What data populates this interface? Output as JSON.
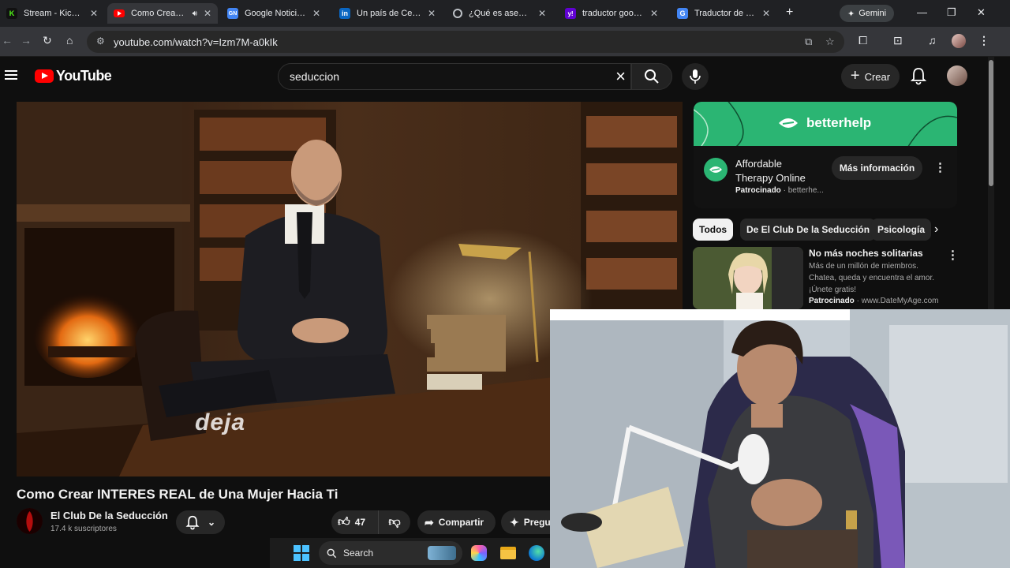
{
  "browser": {
    "tabs": [
      {
        "title": "Stream - Kick Dash",
        "favicon_text": "K",
        "favicon_color": "#53fc18",
        "active": false
      },
      {
        "title": "Como Crear INT",
        "favicon_text": "",
        "favicon_color": "#ff0000",
        "active": true
      },
      {
        "title": "Google Noticias - I",
        "favicon_text": "GN",
        "favicon_color": "#4285f4",
        "active": false
      },
      {
        "title": "Un país de Centro",
        "favicon_text": "in",
        "favicon_color": "#0a66c2",
        "active": false
      },
      {
        "title": "¿Qué es asequibili",
        "favicon_text": "",
        "favicon_color": "#9aa0a6",
        "active": false
      },
      {
        "title": "traductor google -",
        "favicon_text": "y!",
        "favicon_color": "#6001d2",
        "active": false
      },
      {
        "title": "Traductor de Goog",
        "favicon_text": "G",
        "favicon_color": "#4285f4",
        "active": false
      }
    ],
    "gemini_label": "Gemini",
    "url": "youtube.com/watch?v=Izm7M-a0kIk"
  },
  "youtube": {
    "logo_text": "YouTube",
    "search_query": "seduccion",
    "create_label": "Crear",
    "video": {
      "caption": "deja",
      "title": "Como Crear INTERES REAL de Una Mujer Hacia Ti",
      "channel_name": "El Club De la Seducción",
      "subscribers": "17.4 k suscriptores",
      "like_count": "47",
      "share_label": "Compartir",
      "ask_label": "Pregu"
    },
    "ad": {
      "brand": "betterhelp",
      "title": "Affordable Therapy Online",
      "sponsored_label": "Patrocinado",
      "sponsor_domain": "betterhe...",
      "cta_label": "Más información",
      "brand_color": "#2bb573"
    },
    "chips": [
      "Todos",
      "De El Club De la Seducción",
      "Psicología"
    ],
    "recommendation": {
      "title": "No más noches solitarias",
      "description": "Más de un millón de miembros. Chatea, queda y encuentra el amor. ¡Únete gratis!",
      "sponsored_label": "Patrocinado",
      "domain": "www.DateMyAge.com"
    }
  },
  "taskbar": {
    "search_label": "Search"
  }
}
